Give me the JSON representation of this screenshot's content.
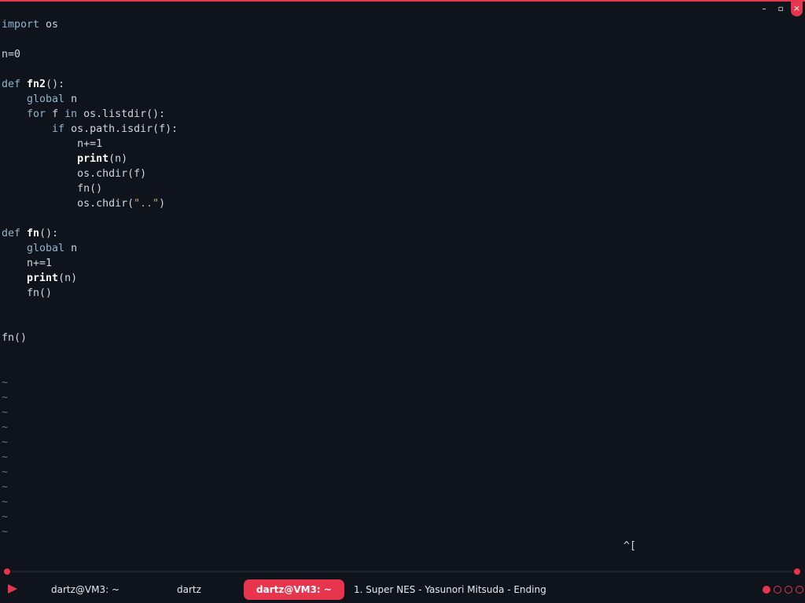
{
  "window": {
    "minimize_glyph": "–",
    "maximize_glyph": "▫",
    "close_glyph": "×"
  },
  "editor": {
    "lines": {
      "l1": {
        "kw": "import",
        "rest": " os"
      },
      "l3": {
        "text": "n=0"
      },
      "l5": {
        "kw": "def",
        "name": "fn2",
        "rest": "():"
      },
      "l6": {
        "indent": "    ",
        "kw": "global",
        "rest": " n"
      },
      "l7": {
        "indent": "    ",
        "kw1": "for",
        "mid": " f ",
        "kw2": "in",
        "rest": " os.listdir():"
      },
      "l8": {
        "indent": "        ",
        "kw": "if",
        "rest": " os.path.isdir(f):"
      },
      "l9": {
        "indent": "            ",
        "text": "n+=1"
      },
      "l10": {
        "indent": "            ",
        "bi": "print",
        "rest": "(n)"
      },
      "l11": {
        "indent": "            ",
        "text": "os.chdir(f)"
      },
      "l12": {
        "indent": "            ",
        "text": "fn()"
      },
      "l13": {
        "indent": "            ",
        "pre": "os.chdir(",
        "str": "\"..\"",
        "post": ")"
      },
      "l15": {
        "kw": "def",
        "name": "fn",
        "rest": "():"
      },
      "l16": {
        "indent": "    ",
        "kw": "global",
        "rest": " n"
      },
      "l17": {
        "indent": "    ",
        "text": "n+=1"
      },
      "l18": {
        "indent": "    ",
        "bi": "print",
        "rest": "(n)"
      },
      "l19": {
        "indent": "    ",
        "text": "fn()"
      },
      "l22": {
        "text": "fn()"
      }
    },
    "tilde": "~",
    "pending_command": "^["
  },
  "taskbar": {
    "tasks": [
      {
        "label": "dartz@VM3: ~"
      },
      {
        "label": "dartz"
      },
      {
        "label": "dartz@VM3: ~"
      },
      {
        "label": "1. Super NES - Yasunori Mitsuda - Ending"
      }
    ],
    "workspaces": [
      "1",
      "2",
      "3",
      "4"
    ],
    "active_workspace": "1"
  },
  "colors": {
    "accent": "#e8354e",
    "background": "#0f141c",
    "keyword": "#8fb4cc",
    "string": "#bfa980"
  }
}
